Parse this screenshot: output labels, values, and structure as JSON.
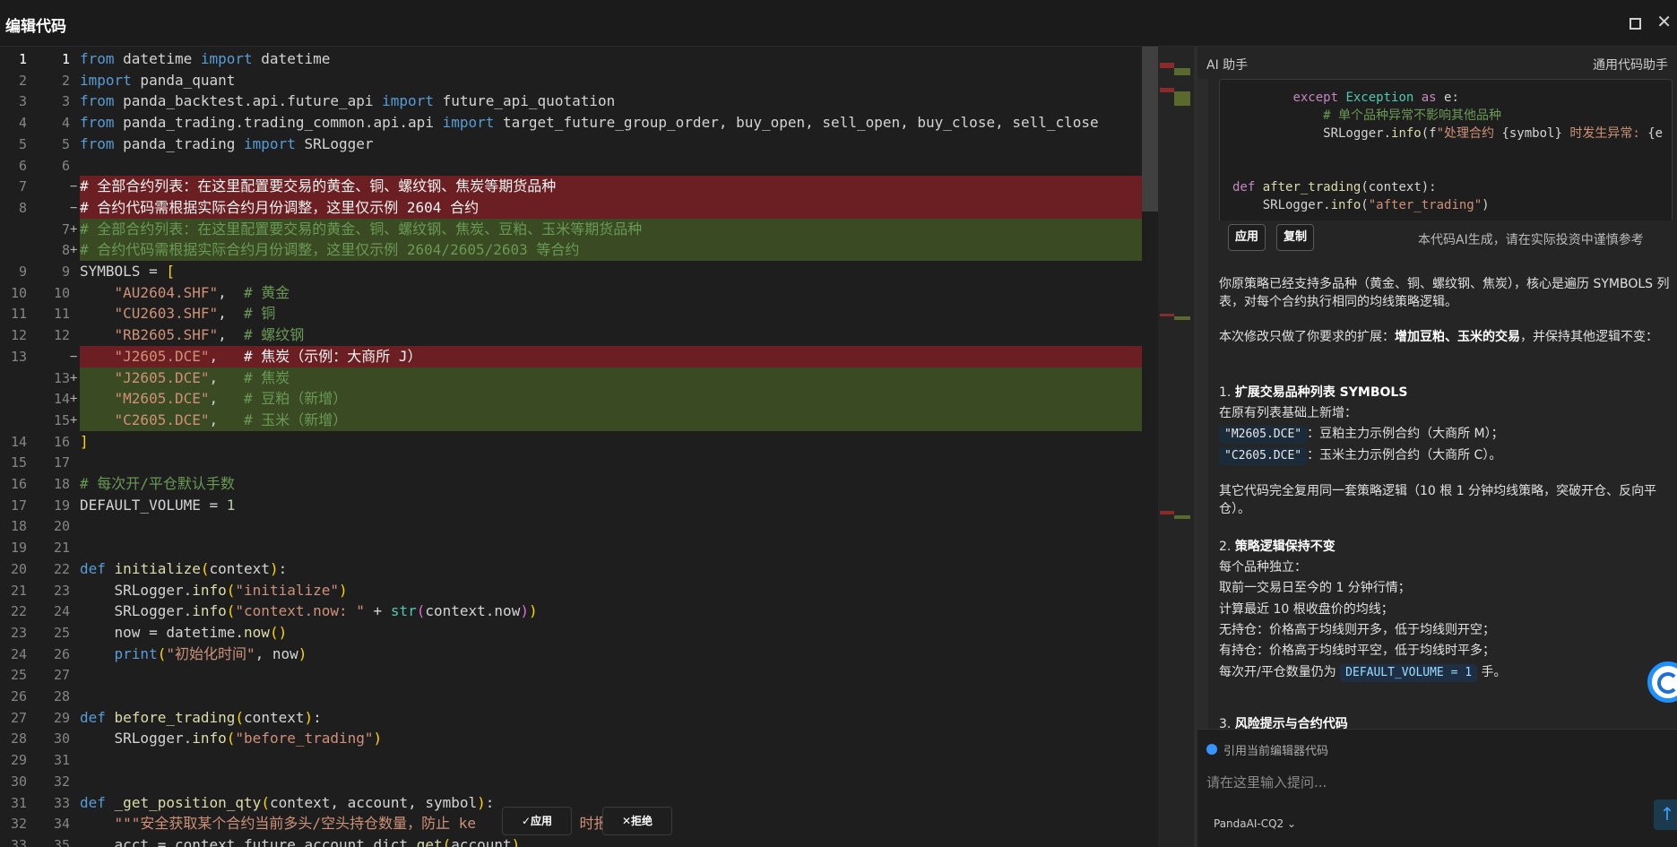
{
  "window": {
    "title": "编辑代码"
  },
  "editor": {
    "lines": [
      {
        "l": "1",
        "r": "1",
        "t": "n",
        "html": "<span class='kw'>from</span> datetime <span class='kw'>import</span> datetime"
      },
      {
        "l": "2",
        "r": "2",
        "t": "n",
        "html": "<span class='kw'>import</span> panda_quant"
      },
      {
        "l": "3",
        "r": "3",
        "t": "n",
        "html": "<span class='kw'>from</span> panda_backtest.api.future_api <span class='kw'>import</span> future_api_quotation"
      },
      {
        "l": "4",
        "r": "4",
        "t": "n",
        "html": "<span class='kw'>from</span> panda_trading.trading_common.api.api <span class='kw'>import</span> target_future_group_order, buy_open, sell_open, buy_close, sell_close"
      },
      {
        "l": "5",
        "r": "5",
        "t": "n",
        "html": "<span class='kw'>from</span> panda_trading <span class='kw'>import</span> SRLogger"
      },
      {
        "l": "6",
        "r": "6",
        "t": "n",
        "html": ""
      },
      {
        "l": "7",
        "r": "",
        "t": "d",
        "html": "<span class='del-txt'># 全部合约列表：在这里配置要交易的黄金、铜、螺纹钢、焦炭等期货品种</span>"
      },
      {
        "l": "8",
        "r": "",
        "t": "d",
        "html": "<span class='del-txt'># 合约代码需根据实际合约月份调整，这里仅示例 2604 合约</span>"
      },
      {
        "l": "",
        "r": "7",
        "t": "a",
        "html": "<span class='add-cm'># 全部合约列表：在这里配置要交易的黄金、铜、螺纹钢、焦炭、豆粕、玉米等期货品种</span>"
      },
      {
        "l": "",
        "r": "8",
        "t": "a",
        "html": "<span class='add-cm'># 合约代码需根据实际合约月份调整，这里仅示例 2604/2605/2603 等合约</span>"
      },
      {
        "l": "9",
        "r": "9",
        "t": "n",
        "html": "SYMBOLS = <span class='br'>[</span>"
      },
      {
        "l": "10",
        "r": "10",
        "t": "n",
        "html": "    <span class='str'>\"AU2604.SHF\"</span>,  <span class='cm'># 黄金</span>"
      },
      {
        "l": "11",
        "r": "11",
        "t": "n",
        "html": "    <span class='str'>\"CU2603.SHF\"</span>,  <span class='cm'># 铜</span>"
      },
      {
        "l": "12",
        "r": "12",
        "t": "n",
        "html": "    <span class='str'>\"RB2605.SHF\"</span>,  <span class='cm'># 螺纹钢</span>"
      },
      {
        "l": "13",
        "r": "",
        "t": "d",
        "html": "    <span class='str'>\"J2605.DCE\"</span>,   <span class='del-txt'># 焦炭（示例：大商所 J）</span>"
      },
      {
        "l": "",
        "r": "13",
        "t": "a",
        "html": "    <span class='str'>\"J2605.DCE\"</span>,   <span class='add-cm'># 焦炭</span>"
      },
      {
        "l": "",
        "r": "14",
        "t": "a",
        "html": "    <span class='str'>\"M2605.DCE\"</span>,   <span class='add-cm'># 豆粕（新增）</span>"
      },
      {
        "l": "",
        "r": "15",
        "t": "a",
        "html": "    <span class='str'>\"C2605.DCE\"</span>,   <span class='add-cm'># 玉米（新增）</span>"
      },
      {
        "l": "14",
        "r": "16",
        "t": "n",
        "html": "<span class='br'>]</span>"
      },
      {
        "l": "15",
        "r": "17",
        "t": "n",
        "html": ""
      },
      {
        "l": "16",
        "r": "18",
        "t": "n",
        "html": "<span class='cm'># 每次开/平仓默认手数</span>"
      },
      {
        "l": "17",
        "r": "19",
        "t": "n",
        "html": "DEFAULT_VOLUME = <span class='num'>1</span>"
      },
      {
        "l": "18",
        "r": "20",
        "t": "n",
        "html": ""
      },
      {
        "l": "19",
        "r": "21",
        "t": "n",
        "html": ""
      },
      {
        "l": "20",
        "r": "22",
        "t": "n",
        "html": "<span class='kw'>def</span> <span class='fn'>initialize</span><span class='br'>(</span>context<span class='br'>)</span>:"
      },
      {
        "l": "21",
        "r": "23",
        "t": "n",
        "html": "    SRLogger.<span class='fn'>info</span><span class='br'>(</span><span class='str'>\"initialize\"</span><span class='br'>)</span>"
      },
      {
        "l": "22",
        "r": "24",
        "t": "n",
        "html": "    SRLogger.<span class='fn'>info</span><span class='br'>(</span><span class='str'>\"context.now: \"</span> + <span class='bi'>str</span><span class='br2'>(</span>context.now<span class='br2'>)</span><span class='br'>)</span>"
      },
      {
        "l": "23",
        "r": "25",
        "t": "n",
        "html": "    now = datetime.<span class='fn'>now</span><span class='br'>()</span>"
      },
      {
        "l": "24",
        "r": "26",
        "t": "n",
        "html": "    <span class='kw'>print</span><span class='br'>(</span><span class='str'>\"初始化时间\"</span>, now<span class='br'>)</span>"
      },
      {
        "l": "25",
        "r": "27",
        "t": "n",
        "html": ""
      },
      {
        "l": "26",
        "r": "28",
        "t": "n",
        "html": ""
      },
      {
        "l": "27",
        "r": "29",
        "t": "n",
        "html": "<span class='kw'>def</span> <span class='fn'>before_trading</span><span class='br'>(</span>context<span class='br'>)</span>:"
      },
      {
        "l": "28",
        "r": "30",
        "t": "n",
        "html": "    SRLogger.<span class='fn'>info</span><span class='br'>(</span><span class='str'>\"before_trading\"</span><span class='br'>)</span>"
      },
      {
        "l": "29",
        "r": "31",
        "t": "n",
        "html": ""
      },
      {
        "l": "30",
        "r": "32",
        "t": "n",
        "html": ""
      },
      {
        "l": "31",
        "r": "33",
        "t": "n",
        "html": "<span class='kw'>def</span> <span class='fn'>_get_position_qty</span><span class='br'>(</span>context, account, symbol<span class='br'>)</span>:"
      },
      {
        "l": "32",
        "r": "34",
        "t": "n",
        "html": "    <span class='str'>\"\"\"安全获取某个合约当前多头/空头持仓数量，防止 ke            时报错</span>"
      },
      {
        "l": "33",
        "r": "35",
        "t": "n",
        "html": "    acct = context.future_account_dict.<span class='fn'>get</span><span class='br'>(</span>account<span class='br'>)</span>"
      }
    ],
    "diff_apply_label": "✓应用",
    "diff_reject_label": "✕拒绝"
  },
  "ai_panel": {
    "header_left": "AI 助手",
    "header_right": "通用代码助手",
    "code_card_lines": [
      "        <span class='kw2'>except</span> <span class='bi'>Exception</span> <span class='kw2'>as</span> e:",
      "            <span class='cm'># 单个品种异常不影响其他品种</span>",
      "            SRLogger.<span class='fn'>info</span>(f<span class='str'>\"处理合约 </span><span class='pl'>{symbol}</span><span class='str'> 时发生异常: </span><span class='pl'>{e</span>",
      "",
      "",
      "<span class='kw2'>def</span> <span class='fn'>after_trading</span>(context):",
      "    SRLogger.<span class='fn'>info</span>(<span class='str'>\"after_trading\"</span>)"
    ],
    "apply_label": "应用",
    "copy_label": "复制",
    "disclaimer": "本代码AI生成，请在实际投资中谨慎参考",
    "msg_p1": "你原策略已经支持多品种（黄金、铜、螺纹钢、焦炭），核心是遍历 SYMBOLS 列表，对每个合约执行相同的均线策略逻辑。",
    "msg_p2_prefix": "本次修改只做了你要求的扩展：",
    "msg_p2_bold": "增加豆粕、玉米的交易",
    "msg_p2_suffix": "，并保持其他逻辑不变：",
    "h1_num": "1.",
    "h1": "扩展交易品种列表 SYMBOLS",
    "h1_line": "在原有列表基础上新增：",
    "code_m": "\"M2605.DCE\"",
    "desc_m": "：豆粕主力示例合约（大商所 M）；",
    "code_c": "\"C2605.DCE\"",
    "desc_c": "：玉米主力示例合约（大商所 C）。",
    "p3": "其它代码完全复用同一套策略逻辑（10 根 1 分钟均线策略，突破开仓、反向平仓）。",
    "h2_num": "2.",
    "h2": "策略逻辑保持不变",
    "h2_lines": [
      "每个品种独立：",
      "取前一交易日至今的 1 分钟行情；",
      "计算最近 10 根收盘价的均线；",
      "无持仓：价格高于均线则开多，低于均线则开空；",
      "有持仓：价格高于均线时平空，低于均线时平多；"
    ],
    "vol_prefix": "每次开/平仓数量仍为",
    "vol_code": "DEFAULT_VOLUME = 1",
    "vol_suffix": "手。",
    "h3_num": "3.",
    "h3": "风险提示与合约代码",
    "ref_label": "引用当前编辑器代码",
    "input_placeholder": "请在这里输入提问...",
    "model_label": "PandaAI-CQ2 ⌄",
    "send_icon": "↑"
  },
  "colors": {
    "removed_bg": "#6b1f22",
    "added_bg": "#3a4a23",
    "accent": "#3794ff"
  }
}
